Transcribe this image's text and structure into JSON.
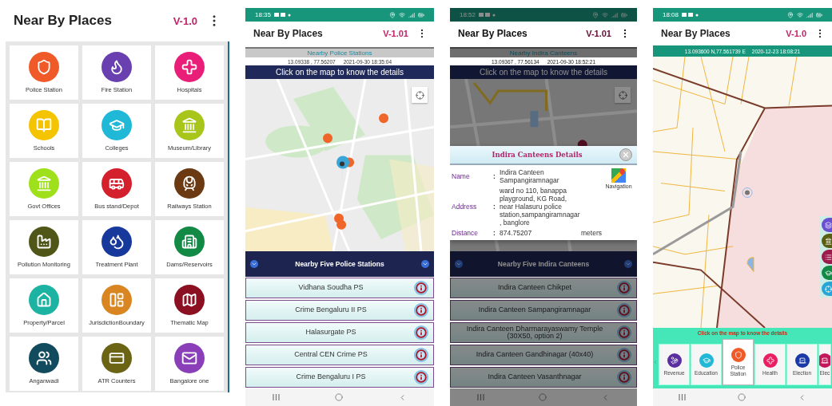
{
  "screens": [
    {
      "kind": "menu",
      "title": "Near By Places",
      "version": "V-1.0",
      "tiles": [
        {
          "label": "Police Station",
          "color": "#f05a28"
        },
        {
          "label": "Fire Station",
          "color": "#6a3fb0"
        },
        {
          "label": "Hospitals",
          "color": "#e91e79"
        },
        {
          "label": "Schools",
          "color": "#f5c400"
        },
        {
          "label": "Colleges",
          "color": "#1fb8d6"
        },
        {
          "label": "Museum/Library",
          "color": "#a8c51c"
        },
        {
          "label": "Govt Offices",
          "color": "#9ee01a"
        },
        {
          "label": "Bus stand/Depot",
          "color": "#d41f2c"
        },
        {
          "label": "Railways Station",
          "color": "#6b3a12"
        },
        {
          "label": "Pollution Monitoring",
          "color": "#4f5617"
        },
        {
          "label": "Treatment Plant",
          "color": "#17399c"
        },
        {
          "label": "Dams/Reservoirs",
          "color": "#128a45"
        },
        {
          "label": "Property/Parcel",
          "color": "#1cb3a3"
        },
        {
          "label": "JurisdictionBoundary",
          "color": "#d98522"
        },
        {
          "label": "Thematic Map",
          "color": "#8b1021"
        },
        {
          "label": "Anganwadi",
          "color": "#124b5e"
        },
        {
          "label": "ATR Counters",
          "color": "#6b6414"
        },
        {
          "label": "Bangalore one",
          "color": "#8a3fb8"
        }
      ]
    },
    {
      "kind": "list",
      "time": "18:35",
      "title": "Near By Places",
      "version": "V-1.01",
      "layer": "Nearby Police Stations",
      "coords": "13.09338 , 77.56207",
      "timestamp": "2021-09-30 18:35:04",
      "banner": "Click on the map to know the details",
      "list_title": "Nearby Five Police Stations",
      "items": [
        "Vidhana Soudha PS",
        "Crime Bengaluru II PS",
        "Halasurgate PS",
        "Central CEN Crime PS",
        "Crime Bengaluru I PS"
      ]
    },
    {
      "kind": "list",
      "time": "18:52",
      "title": "Near By Places",
      "version": "V-1.01",
      "layer": "Nearby Indira Canteens",
      "coords": "13.09367 , 77.56134",
      "timestamp": "2021-09-30 18:52:21",
      "banner": "Click on the map to know the details",
      "list_title": "Nearby Five Indira Canteens",
      "items": [
        "Indira Canteen Chikpet",
        "Indira Canteen Sampangiramnagar",
        "Indira Canteen Dharmarayaswamy Temple (30X50, option 2)",
        "Indira Canteen Gandhinagar (40x40)",
        "Indira Canteen Vasanthnagar"
      ],
      "dialog": {
        "title": "Indira Canteens Details",
        "navigation": "Navigation",
        "fields": [
          {
            "label": "Name",
            "sep": ":",
            "value": "Indira Canteen Sampangiramnagar"
          },
          {
            "label": "Address",
            "sep": ":",
            "value": "ward no 110, banappa playground, KG Road, near Halasuru police station,sampangiramnagar, banglore"
          },
          {
            "label": "Distance",
            "sep": ":",
            "value": "874.75207",
            "unit": "meters"
          }
        ]
      }
    },
    {
      "kind": "map",
      "time": "18:08",
      "title": "Near By Places",
      "version": "V-1.0",
      "coords": "13.093600 N,77.561739 E",
      "timestamp": "2020-12-23 18:08:21",
      "banner": "Click on the map to know the details",
      "tabs": [
        {
          "label": "Revenue",
          "color": "#5b2fa0",
          "selected": false
        },
        {
          "label": "Education",
          "color": "#1fb8d6",
          "selected": false
        },
        {
          "label": "Police Station",
          "color": "#f05a28",
          "selected": true
        },
        {
          "label": "Health",
          "color": "#e91e63",
          "selected": false
        },
        {
          "label": "Election",
          "color": "#1a3aa8",
          "selected": false
        },
        {
          "label": "Elec",
          "color": "#c2185b",
          "selected": false
        }
      ]
    }
  ]
}
